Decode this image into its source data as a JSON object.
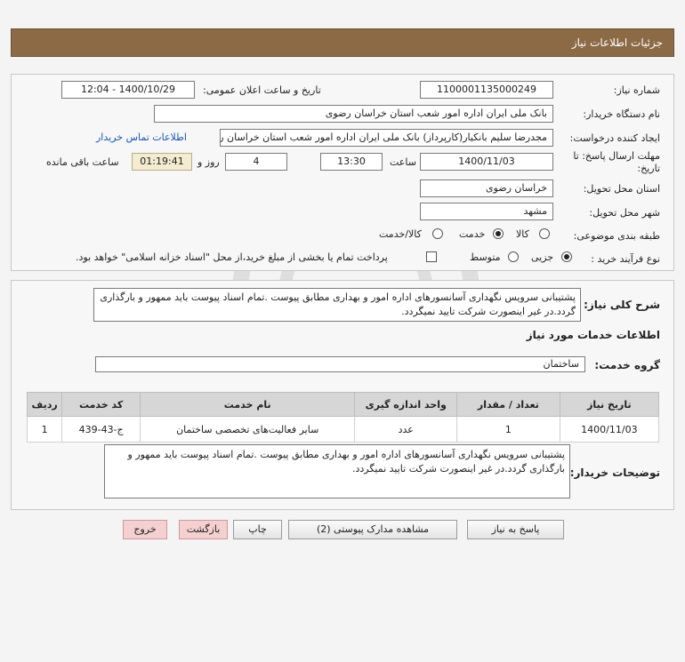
{
  "header": {
    "title": "جزئیات اطلاعات نیاز"
  },
  "fields": {
    "need_number_label": "شماره نیاز:",
    "need_number": "1100001135000249",
    "announce_label": "تاریخ و ساعت اعلان عمومی:",
    "announce_value": "1400/10/29 - 12:04",
    "buyer_label": "نام دستگاه خریدار:",
    "buyer_value": "بانک ملی ایران اداره امور شعب استان خراسان رضوی",
    "creator_label": "ایجاد کننده درخواست:",
    "creator_value": "مجدرضا سلیم  بانکیار(کارپرداز) بانک ملی ایران اداره امور شعب استان خراسان ر",
    "contact_link": "اطلاعات تماس خریدار",
    "deadline_label": "مهلت ارسال پاسخ: تا تاریخ:",
    "deadline_date": "1400/11/03",
    "time_label": "ساعت",
    "deadline_time": "13:30",
    "days_value": "4",
    "days_label": "روز و",
    "remaining_time": "01:19:41",
    "remaining_label": "ساعت باقی مانده",
    "province_label": "استان محل تحویل:",
    "province_value": "خراسان رضوی",
    "city_label": "شهر محل تحویل:",
    "city_value": "مشهد",
    "category_label": "طبقه بندی موضوعی:",
    "category_options": [
      "کالا",
      "خدمت",
      "کالا/خدمت"
    ],
    "process_label": "نوع فرآیند خرید :",
    "process_options": [
      "جزیی",
      "متوسط"
    ],
    "payment_note": "پرداخت تمام یا بخشی از مبلغ خرید،از محل \"اسناد خزانه اسلامی\" خواهد بود."
  },
  "summary": {
    "label": "شرح کلی نیاز:",
    "text": "پشتیبانی سرویس نگهداری آسانسورهای اداره امور و بهداری مطابق پیوست .تمام اسناد پیوست باید ممهور و بارگذاری گردد.در غیر اینصورت شرکت تایید نمیگردد.",
    "services_title": "اطلاعات خدمات مورد نیاز",
    "group_label": "گروه خدمت:",
    "group_value": "ساختمان"
  },
  "table": {
    "headers": [
      "ردیف",
      "کد خدمت",
      "نام خدمت",
      "واحد اندازه گیری",
      "تعداد / مقدار",
      "تاریخ نیاز"
    ],
    "rows": [
      [
        "1",
        "ج-43-439",
        "سایر فعالیت‌های تخصصی ساختمان",
        "عدد",
        "1",
        "1400/11/03"
      ]
    ]
  },
  "buyer_notes": {
    "label": "توضیحات خریدار:",
    "text": "پشتیبانی سرویس نگهداری آسانسورهای اداره امور و بهداری مطابق پیوست .تمام اسناد پیوست باید ممهور و بارگذاری گردد.در غیر اینصورت شرکت تایید نمیگردد."
  },
  "buttons": {
    "reply": "پاسخ به نیاز",
    "view_docs": "مشاهده مدارک پیوستی (2)",
    "print": "چاپ",
    "back": "بازگشت",
    "exit": "خروج"
  }
}
